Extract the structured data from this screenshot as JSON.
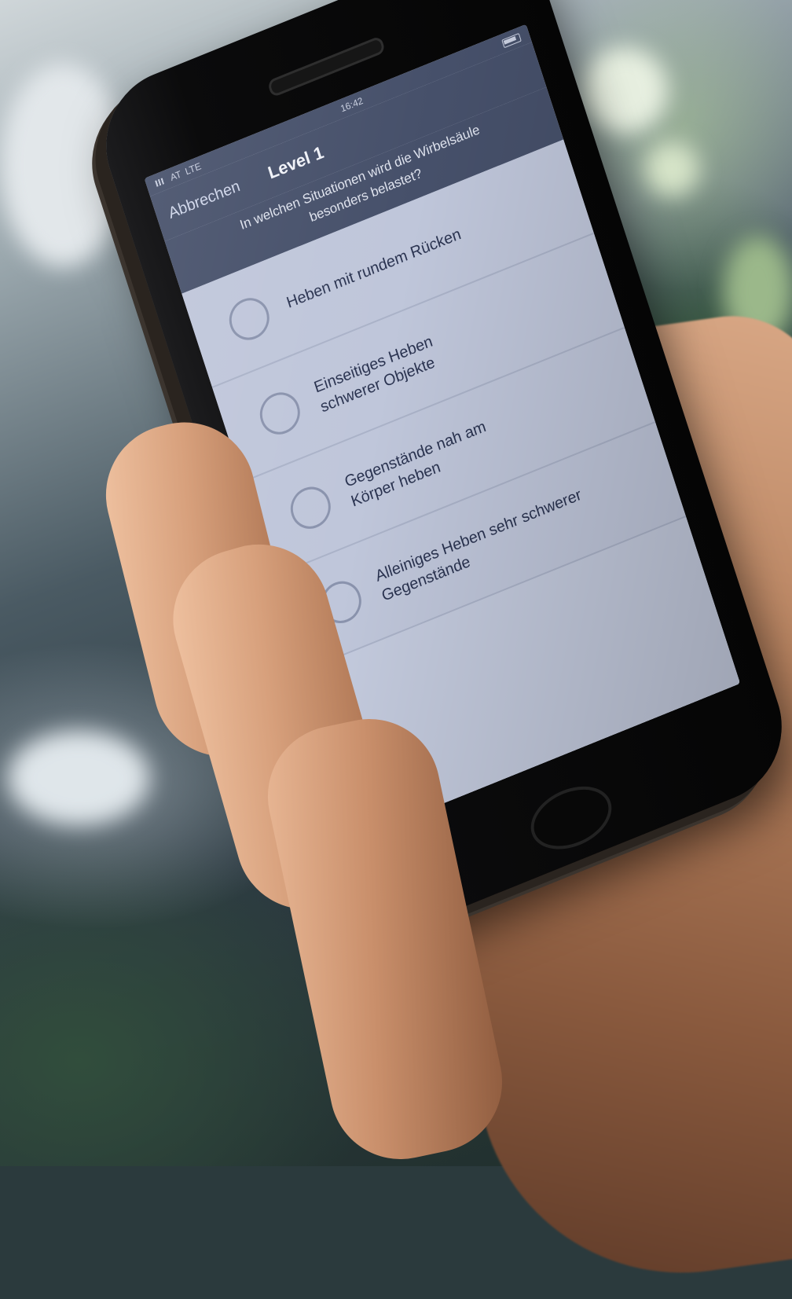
{
  "status_bar": {
    "carrier": "AT",
    "network": "LTE",
    "time": "16:42"
  },
  "nav": {
    "cancel_label": "Abbrechen",
    "title": "Level 1"
  },
  "question": {
    "line1": "In welchen Situationen wird die Wirbelsäule",
    "line2": "besonders belastet?"
  },
  "answers": [
    {
      "line1": "Heben mit rundem Rücken",
      "line2": ""
    },
    {
      "line1": "Einseitiges Heben",
      "line2": "schwerer Objekte"
    },
    {
      "line1": "Gegenstände nah am",
      "line2": "Körper heben"
    },
    {
      "line1": "Alleiniges Heben sehr schwerer",
      "line2": "Gegenstände"
    }
  ],
  "icons": {
    "signal": "signal-icon",
    "battery": "battery-icon",
    "radio": "radio-unselected-icon"
  }
}
